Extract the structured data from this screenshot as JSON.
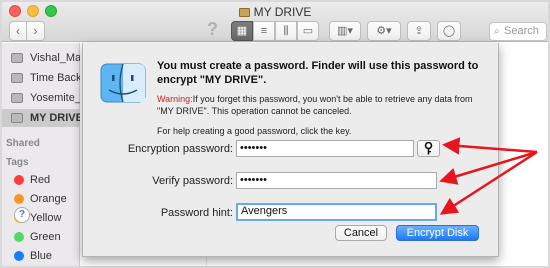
{
  "window": {
    "title": "MY DRIVE",
    "search_placeholder": "Search"
  },
  "toolbar": {
    "back_label": "‹",
    "forward_label": "›",
    "help_label": "?",
    "view_icons": [
      "▦",
      "≡",
      "⫼",
      "▭"
    ]
  },
  "sidebar": {
    "devices": [
      {
        "label": "Vishal_Mav"
      },
      {
        "label": "Time Backu"
      },
      {
        "label": "Yosemite_V"
      },
      {
        "label": "MY DRIVE",
        "selected": true
      }
    ],
    "shared_heading": "Shared",
    "tags_heading": "Tags",
    "tags": [
      {
        "label": "Red",
        "color": "#fc3d39"
      },
      {
        "label": "Orange",
        "color": "#fd9426"
      },
      {
        "label": "Yellow",
        "color": "#fecb2e"
      },
      {
        "label": "Green",
        "color": "#53d769"
      },
      {
        "label": "Blue",
        "color": "#147efb"
      }
    ]
  },
  "dialog": {
    "title": "You must create a password. Finder will use this password to encrypt \"MY DRIVE\".",
    "warning_label": "Warning:",
    "warning_text": "If you forget this password, you won't be able to retrieve any data from \"MY DRIVE\". This operation cannot be canceled.",
    "help_text": "For help creating a good password, click the key.",
    "encryption_label": "Encryption password:",
    "encryption_value": "•••••••",
    "verify_label": "Verify password:",
    "verify_value": "•••••••",
    "hint_label": "Password hint:",
    "hint_value": "Avengers",
    "key_icon": "key-icon",
    "help_button": "?",
    "cancel_label": "Cancel",
    "encrypt_label": "Encrypt Disk"
  },
  "colors": {
    "accent": "#1d7bf0",
    "warning": "#d1201e",
    "annotation_arrow": "#e8141e"
  }
}
